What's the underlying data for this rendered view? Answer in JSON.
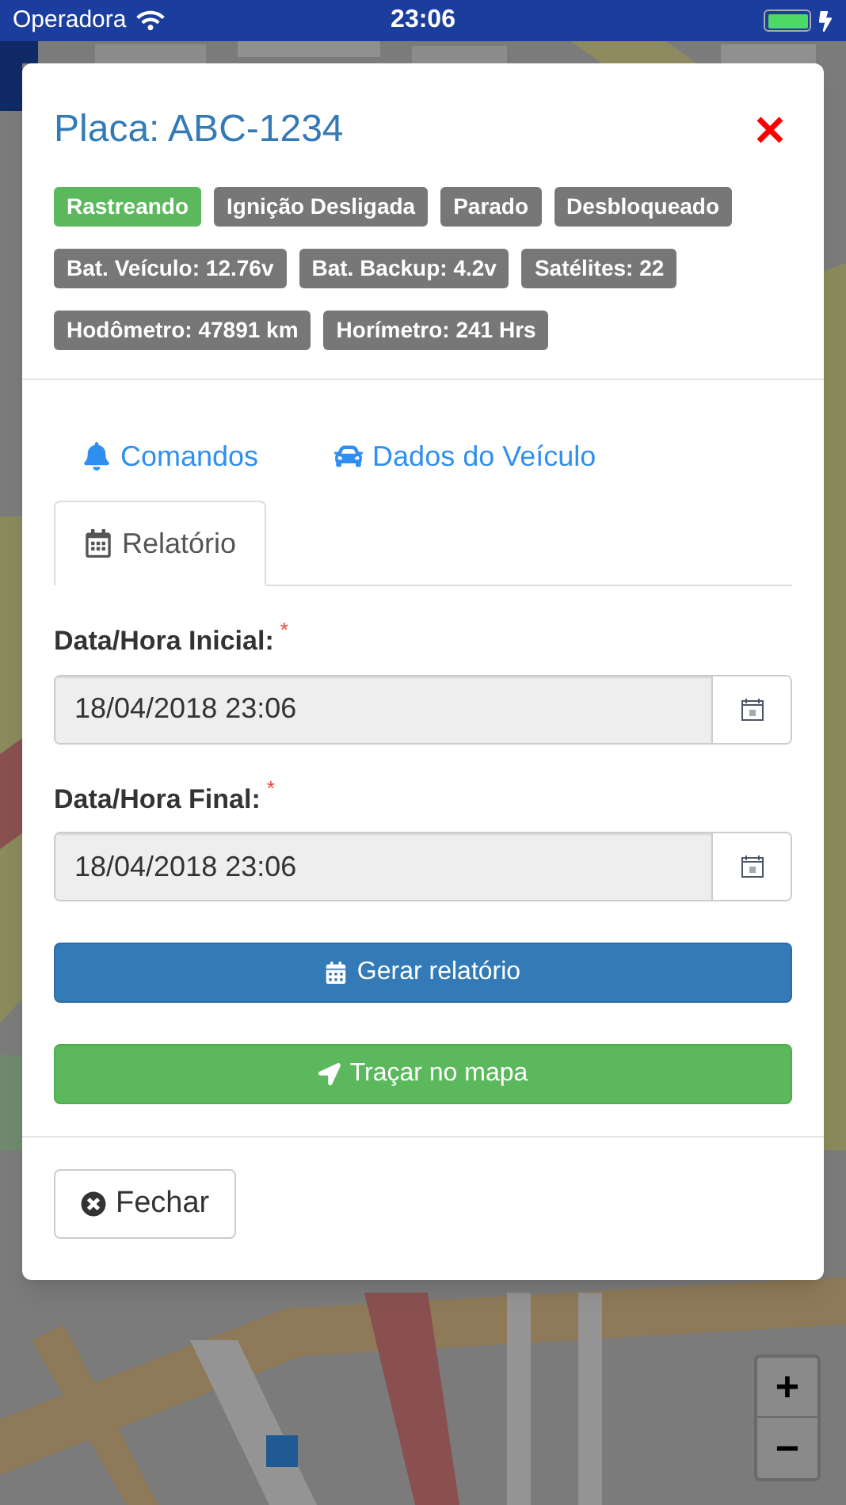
{
  "status_bar": {
    "carrier": "Operadora",
    "time": "23:06"
  },
  "map": {
    "kind": "picture",
    "zoom_in": "+",
    "zoom_out": "−"
  },
  "modal": {
    "title": "Placa: ABC-1234",
    "badges": [
      {
        "text": "Rastreando",
        "color": "#5cb85c"
      },
      {
        "text": "Ignição Desligada",
        "color": "#777777"
      },
      {
        "text": "Parado",
        "color": "#777777"
      },
      {
        "text": "Desbloqueado",
        "color": "#777777"
      },
      {
        "text": "Bat. Veículo: 12.76v",
        "color": "#777777"
      },
      {
        "text": "Bat. Backup: 4.2v",
        "color": "#777777"
      },
      {
        "text": "Satélites: 22",
        "color": "#777777"
      },
      {
        "text": "Hodômetro: 47891 km",
        "color": "#777777"
      },
      {
        "text": "Horímetro: 241 Hrs",
        "color": "#777777"
      }
    ],
    "tabs": [
      {
        "label": "Comandos",
        "selected": false
      },
      {
        "label": "Dados do Veículo",
        "selected": false
      },
      {
        "label": "Relatório",
        "selected": true
      }
    ],
    "fields": [
      {
        "label": "Data/Hora Inicial:",
        "required": true,
        "required_mark": "*",
        "value": "18/04/2018 23:06"
      },
      {
        "label": "Data/Hora Final:",
        "required": true,
        "required_mark": "*",
        "value": "18/04/2018 23:06"
      }
    ],
    "actions": [
      {
        "label": "Gerar relatório",
        "kind": "primary"
      },
      {
        "label": "Traçar no mapa",
        "kind": "success"
      }
    ],
    "close_button": "Fechar"
  }
}
